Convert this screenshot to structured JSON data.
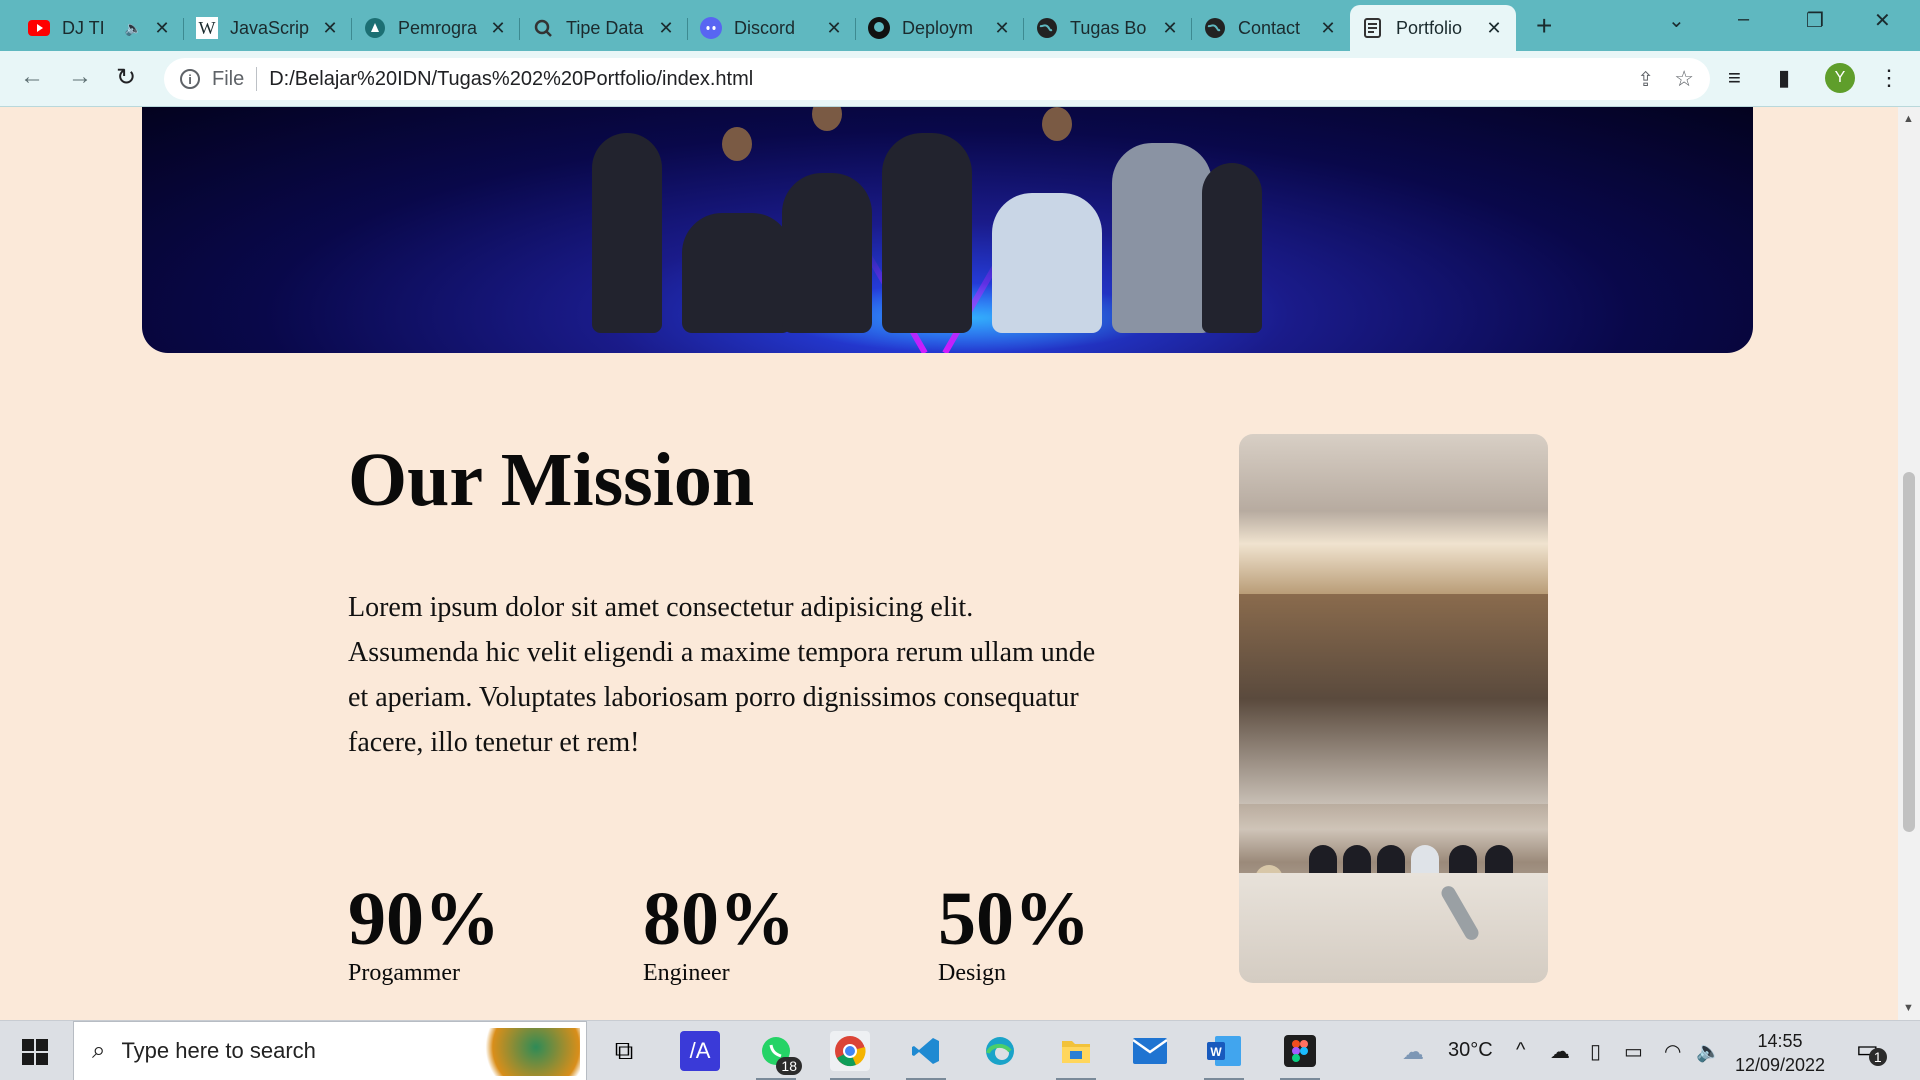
{
  "browser": {
    "tabs": [
      {
        "title": "DJ TI",
        "icon": "youtube-icon",
        "audio": "speaker-icon"
      },
      {
        "title": "JavaScrip",
        "icon": "wikipedia-icon"
      },
      {
        "title": "Pemrogra",
        "icon": "site-icon"
      },
      {
        "title": "Tipe Data",
        "icon": "site-icon"
      },
      {
        "title": "Discord",
        "icon": "discord-icon"
      },
      {
        "title": "Deploym",
        "icon": "github-icon"
      },
      {
        "title": "Tugas Bo",
        "icon": "globe-icon"
      },
      {
        "title": "Contact",
        "icon": "globe-icon"
      },
      {
        "title": "Portfolio",
        "icon": "page-icon",
        "active": true
      }
    ],
    "address": {
      "scheme": "File",
      "url": "D:/Belajar%20IDN/Tugas%202%20Portfolio/index.html"
    },
    "profile_initial": "Y"
  },
  "page": {
    "mission": {
      "title": "Our Mission",
      "text": "Lorem ipsum dolor sit amet consectetur adipisicing elit. Assumenda hic velit eligendi a maxime tempora rerum ullam unde et aperiam. Voluptates laboriosam porro dignissimos consequatur facere, illo tenetur et rem!"
    },
    "stats": [
      {
        "value": "90%",
        "label": "Progammer"
      },
      {
        "value": "80%",
        "label": "Engineer"
      },
      {
        "value": "50%",
        "label": "Design"
      }
    ]
  },
  "taskbar": {
    "search_placeholder": "Type here to search",
    "whatsapp_badge": "18",
    "weather": "30°C",
    "time": "14:55",
    "date": "12/09/2022",
    "notification_count": "1"
  }
}
